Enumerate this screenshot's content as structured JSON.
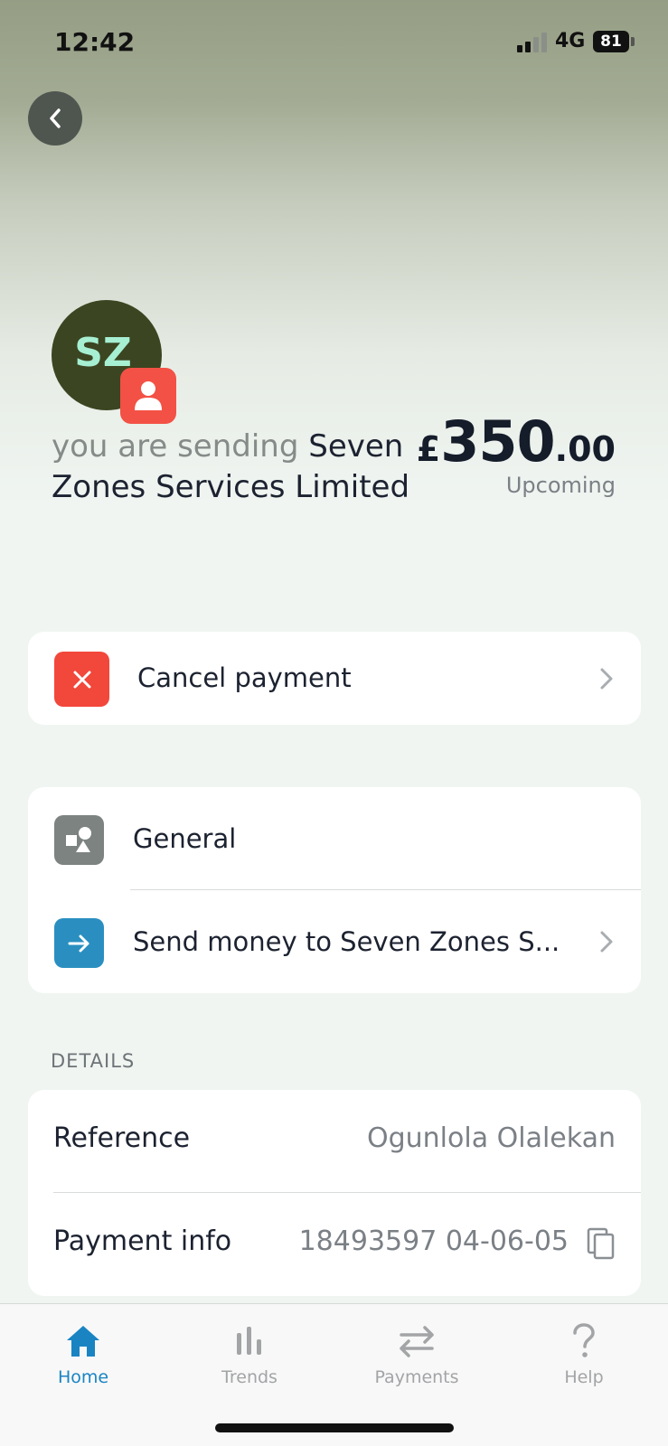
{
  "status_bar": {
    "time": "12:42",
    "network": "4G",
    "battery": "81"
  },
  "recipient": {
    "initials": "SZ",
    "prefix": "you are sending",
    "name": "Seven Zones Services Limited"
  },
  "amount": {
    "currency": "£",
    "whole": "350",
    "decimal": ".00",
    "status": "Upcoming"
  },
  "actions": {
    "cancel_label": "Cancel payment"
  },
  "category": {
    "label": "General",
    "send_label": "Send money to Seven Zones S..."
  },
  "details": {
    "header": "DETAILS",
    "reference_label": "Reference",
    "reference_value": "Ogunlola Olalekan",
    "payment_info_label": "Payment info",
    "payment_info_value": "18493597 04-06-05"
  },
  "tabbar": {
    "items": [
      {
        "label": "Home",
        "icon": "home-icon",
        "active": true
      },
      {
        "label": "Trends",
        "icon": "bar-chart-icon",
        "active": false
      },
      {
        "label": "Payments",
        "icon": "transfer-arrows-icon",
        "active": false
      },
      {
        "label": "Help",
        "icon": "question-icon",
        "active": false
      }
    ]
  },
  "colors": {
    "accent": "#1a84c3",
    "cancel_red": "#f2473b",
    "avatar_bg": "#3b4521",
    "avatar_text": "#a6efd2",
    "send_blue": "#2a8fc0"
  }
}
